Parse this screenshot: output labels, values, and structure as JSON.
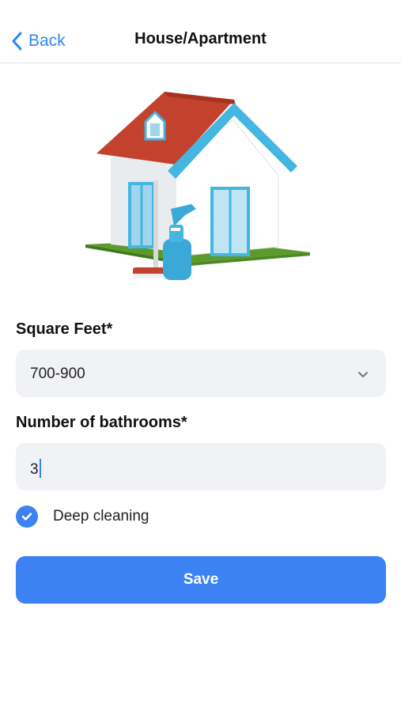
{
  "nav": {
    "back_label": "Back",
    "back_icon": "chevron-left-icon",
    "title": "House/Apartment"
  },
  "hero": {
    "image": "house-with-spray-bottle-illustration"
  },
  "form": {
    "square_feet": {
      "label": "Square Feet*",
      "selected_value": "700-900",
      "icon": "chevron-down-icon"
    },
    "bathrooms": {
      "label": "Number of bathrooms*",
      "value": "3"
    },
    "deep_cleaning": {
      "label": "Deep cleaning",
      "checked": true
    }
  },
  "actions": {
    "save_label": "Save"
  },
  "colors": {
    "accent": "#3d82f5",
    "link": "#2f86f0",
    "field_bg": "#f1f2f5",
    "roof": "#c2422e",
    "trim": "#45b6e0"
  }
}
